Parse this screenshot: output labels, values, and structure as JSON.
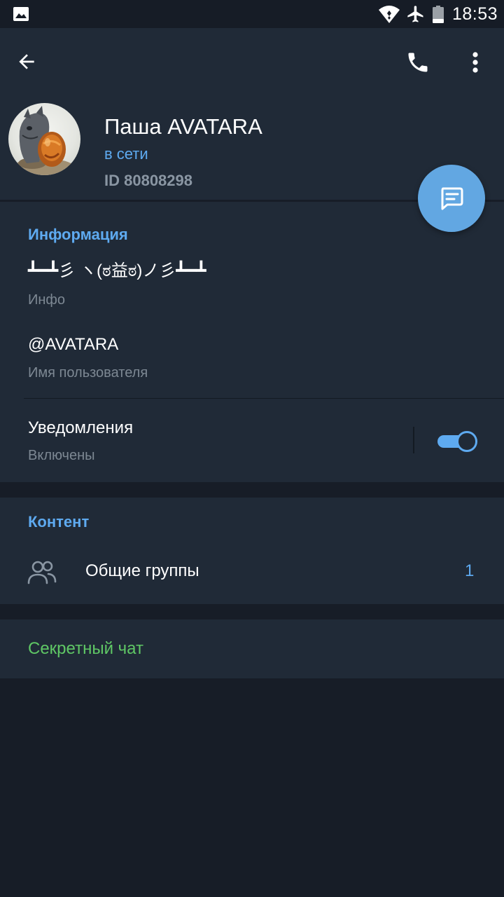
{
  "status_bar": {
    "time": "18:53",
    "icons": [
      "image-notification-icon",
      "wifi-icon",
      "airplane-mode-icon",
      "battery-icon"
    ]
  },
  "header": {
    "icons": [
      "back-arrow-icon",
      "phone-icon",
      "more-vertical-icon"
    ]
  },
  "profile": {
    "name": "Паша AVATARA",
    "status": "в сети",
    "id": "ID 80808298"
  },
  "fab": {
    "icon": "message-icon"
  },
  "info": {
    "title": "Информация",
    "bio": "┻━┻彡 ヽ(ಠ益ಠ)ノ彡┻━┻",
    "bio_label": "Инфо",
    "username": "@AVATARA",
    "username_label": "Имя пользователя",
    "notifications_label": "Уведомления",
    "notifications_status": "Включены",
    "notifications_enabled": true
  },
  "content": {
    "title": "Контент",
    "groups_label": "Общие группы",
    "groups_count": "1",
    "groups_icon": "people-icon"
  },
  "secret_chat": {
    "label": "Секретный чат"
  },
  "colors": {
    "background": "#171d27",
    "surface": "#202a37",
    "accent": "#5eaaf0",
    "fab": "#62a7e2",
    "secret": "#5fc765",
    "secondary_text": "#7d8893"
  }
}
